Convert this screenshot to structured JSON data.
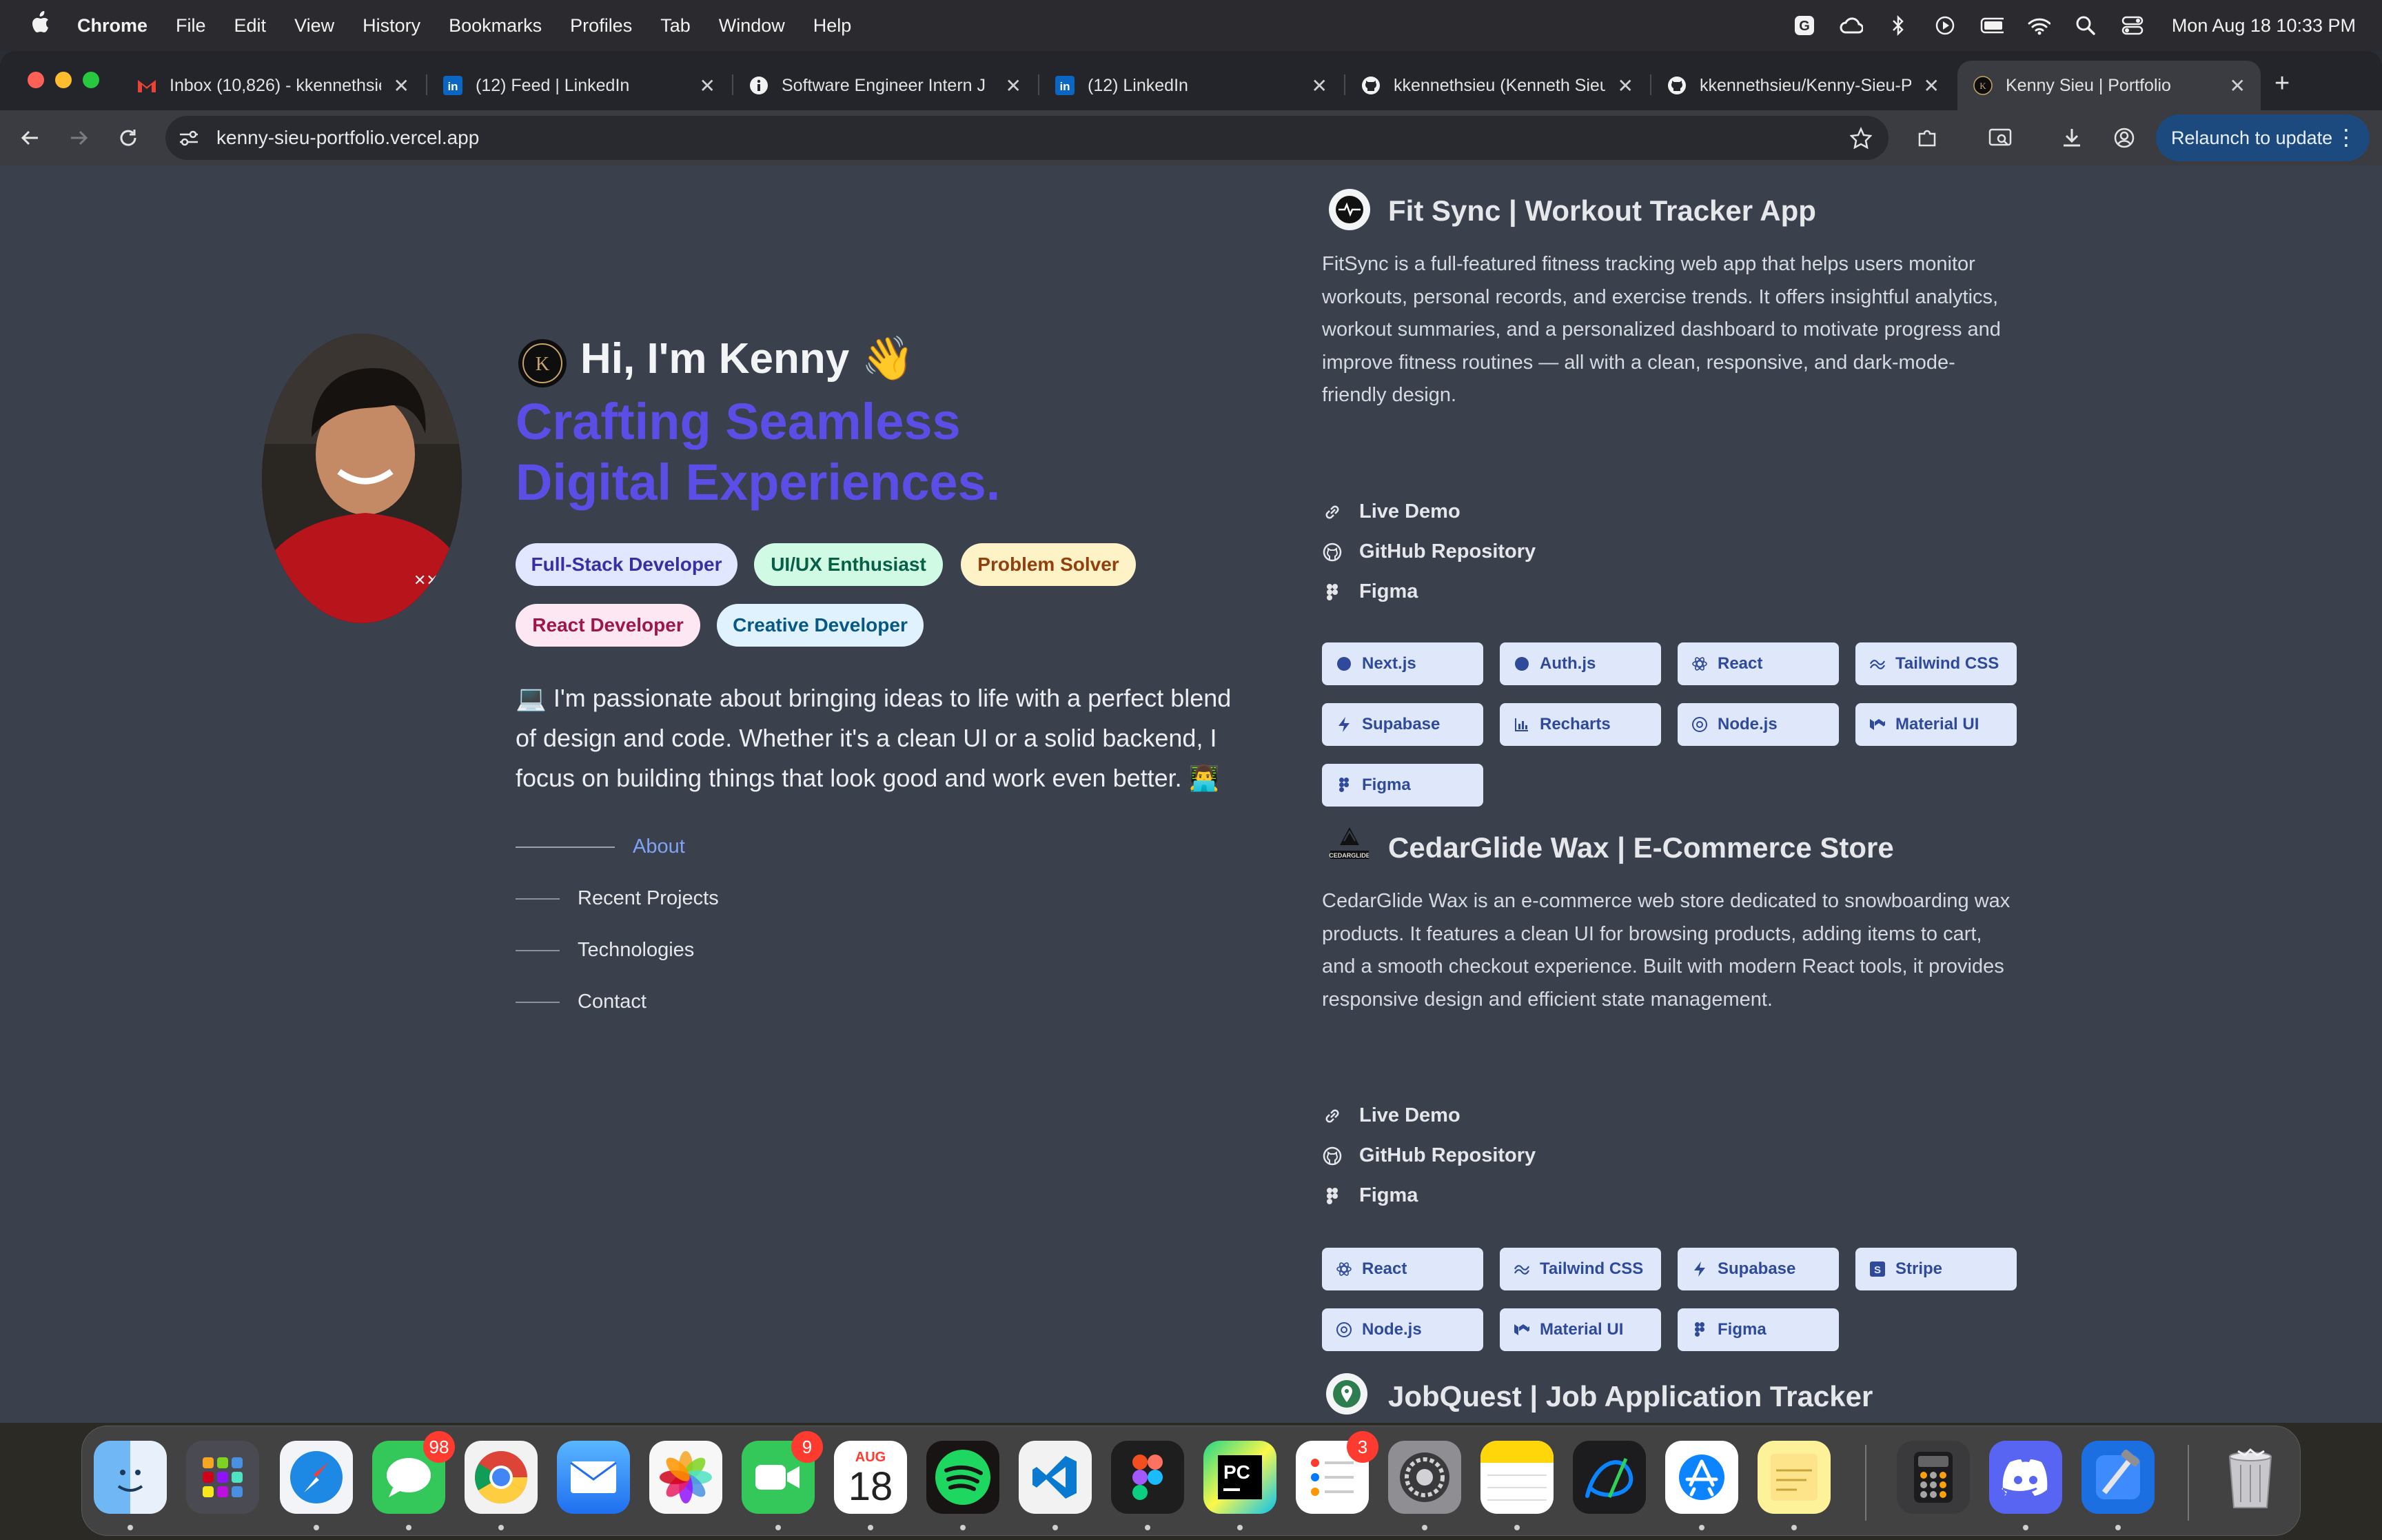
{
  "menubar": {
    "app_name": "Chrome",
    "items": [
      "File",
      "Edit",
      "View",
      "History",
      "Bookmarks",
      "Profiles",
      "Tab",
      "Window",
      "Help"
    ],
    "clock": "Mon Aug 18  10:33 PM"
  },
  "tabs": [
    {
      "title": "Inbox (10,826) - kkennethsieu",
      "icon": "gmail-icon"
    },
    {
      "title": "(12) Feed | LinkedIn",
      "icon": "linkedin-icon"
    },
    {
      "title": "Software Engineer Intern J",
      "icon": "info-icon"
    },
    {
      "title": "(12) LinkedIn",
      "icon": "linkedin-icon"
    },
    {
      "title": "kkennethsieu (Kenneth Sieu",
      "icon": "github-icon"
    },
    {
      "title": "kkennethsieu/Kenny-Sieu-P",
      "icon": "github-icon"
    },
    {
      "title": "Kenny Sieu | Portfolio",
      "icon": "portfolio-icon",
      "active": true
    }
  ],
  "toolbar": {
    "url": "kenny-sieu-portfolio.vercel.app",
    "relaunch_label": "Relaunch to update"
  },
  "intro": {
    "greeting": "Hi, I'm Kenny 👋",
    "headline_line1": "Crafting Seamless",
    "headline_line2": "Digital Experiences.",
    "headline_color": "#5b4ee6",
    "pills": [
      {
        "label": "Full-Stack Developer",
        "bg": "#e0e7ff",
        "fg": "#3730a3"
      },
      {
        "label": "UI/UX Enthusiast",
        "bg": "#d1fae5",
        "fg": "#065f46"
      },
      {
        "label": "Problem Solver",
        "bg": "#fef3c7",
        "fg": "#92400e"
      },
      {
        "label": "React Developer",
        "bg": "#fce7f3",
        "fg": "#9d174d"
      },
      {
        "label": "Creative Developer",
        "bg": "#e0f2fe",
        "fg": "#075985"
      }
    ],
    "bio": "💻 I'm passionate about bringing ideas to life with a perfect blend of design and code. Whether it's a clean UI or a solid backend, I focus on building things that look good and work even better. 👨‍💻",
    "nav": [
      "About",
      "Recent Projects",
      "Technologies",
      "Contact"
    ]
  },
  "projects": [
    {
      "title": "Fit Sync | Workout Tracker App",
      "description": "FitSync is a full-featured fitness tracking web app that helps users monitor workouts, personal records, and exercise trends. It offers insightful analytics, workout summaries, and a personalized dashboard to motivate progress and improve fitness routines — all with a clean, responsive, and dark-mode-friendly design.",
      "links": [
        "Live Demo",
        "GitHub Repository",
        "Figma"
      ],
      "tech": [
        "Next.js",
        "Auth.js",
        "React",
        "Tailwind CSS",
        "Supabase",
        "Recharts",
        "Node.js",
        "Material UI",
        "Figma"
      ]
    },
    {
      "title": "CedarGlide Wax | E-Commerce Store",
      "description": "CedarGlide Wax is an e-commerce web store dedicated to snowboarding wax products. It features a clean UI for browsing products, adding items to cart, and a smooth checkout experience. Built with modern React tools, it provides responsive design and efficient state management.",
      "links": [
        "Live Demo",
        "GitHub Repository",
        "Figma"
      ],
      "tech": [
        "React",
        "Tailwind CSS",
        "Supabase",
        "Stripe",
        "Node.js",
        "Material UI",
        "Figma"
      ]
    },
    {
      "title": "JobQuest | Job Application Tracker"
    }
  ],
  "dock": {
    "apps": [
      "Finder",
      "Launchpad",
      "Safari",
      "Messages",
      "Chrome",
      "Mail",
      "Photos",
      "FaceTime",
      "Calendar",
      "Spotify",
      "VS Code",
      "Figma",
      "PyCharm",
      "Reminders",
      "System Settings",
      "Notes",
      "Freeform",
      "App Store",
      "Stickies",
      "Calculator",
      "Discord",
      "Xcode",
      "Trash"
    ],
    "messages_badge": "98",
    "facetime_badge": "9",
    "reminders_badge": "3",
    "calendar_month": "AUG",
    "calendar_day": "18"
  }
}
